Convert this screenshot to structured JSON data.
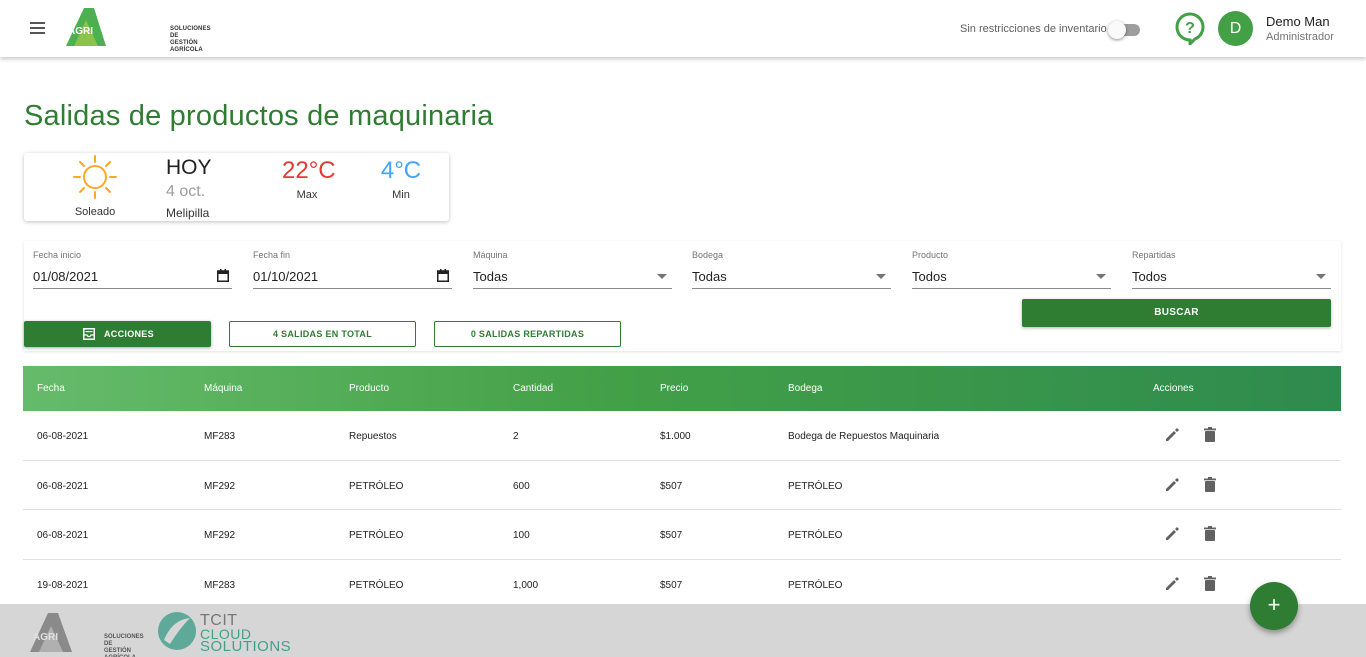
{
  "header": {
    "logo_text_line1": "SOLUCIONES DE",
    "logo_text_line2": "GESTIÓN AGRÍCOLA",
    "logo_brand": "AGRI",
    "inventory_label": "Sin restricciones de inventario",
    "avatar_initial": "D",
    "user_name": "Demo Man",
    "user_role": "Administrador"
  },
  "page": {
    "title": "Salidas de productos de maquinaria"
  },
  "weather": {
    "condition": "Soleado",
    "day": "HOY",
    "date": "4 oct.",
    "city": "Melipilla",
    "max_temp": "22°C",
    "max_label": "Max",
    "min_temp": "4°C",
    "min_label": "Min"
  },
  "filters": {
    "fecha_inicio": {
      "label": "Fecha inicio",
      "value": "01/08/2021"
    },
    "fecha_fin": {
      "label": "Fecha fin",
      "value": "01/10/2021"
    },
    "maquina": {
      "label": "Máquina",
      "value": "Todas"
    },
    "bodega": {
      "label": "Bodega",
      "value": "Todas"
    },
    "producto": {
      "label": "Producto",
      "value": "Todos"
    },
    "repartidas": {
      "label": "Repartidas",
      "value": "Todos"
    },
    "search_label": "BUSCAR"
  },
  "actions": {
    "acciones_label": "ACCIONES",
    "total_label": "4 SALIDAS EN TOTAL",
    "repartidas_label": "0 SALIDAS REPARTIDAS"
  },
  "table": {
    "columns": [
      "Fecha",
      "Máquina",
      "Producto",
      "Cantidad",
      "Precio",
      "Bodega",
      "Acciones"
    ],
    "rows": [
      [
        "06-08-2021",
        "MF283",
        "Repuestos",
        "2",
        "$1.000",
        "Bodega de Repuestos Maquinaria"
      ],
      [
        "06-08-2021",
        "MF292",
        "PETRÓLEO",
        "600",
        "$507",
        "PETRÓLEO"
      ],
      [
        "06-08-2021",
        "MF292",
        "PETRÓLEO",
        "100",
        "$507",
        "PETRÓLEO"
      ],
      [
        "19-08-2021",
        "MF283",
        "PETRÓLEO",
        "1,000",
        "$507",
        "PETRÓLEO"
      ]
    ]
  },
  "footer": {
    "agri_line1": "SOLUCIONES DE",
    "agri_line2": "GESTIÓN AGRÍCOLA",
    "agri_brand": "AGRI",
    "tcit_line1": "TCIT",
    "tcit_line2": "CLOUD",
    "tcit_line3": "SOLUTIONS"
  },
  "fab": {
    "label": "+"
  },
  "colors": {
    "primary_green": "#2e7d32",
    "header_gradient_start": "#66bb6a",
    "header_gradient_end": "#2e8b4e",
    "max_temp": "#e53935",
    "min_temp": "#42a5f5",
    "sun": "#ffa726"
  },
  "icons": {
    "menu": "menu-icon",
    "help": "help-circle-icon",
    "weather": "sun-icon",
    "calendar": "calendar-icon",
    "dropdown": "dropdown-arrow-icon",
    "acciones": "inbox-icon",
    "edit": "pencil-icon",
    "delete": "trash-icon",
    "fab": "plus-icon"
  }
}
